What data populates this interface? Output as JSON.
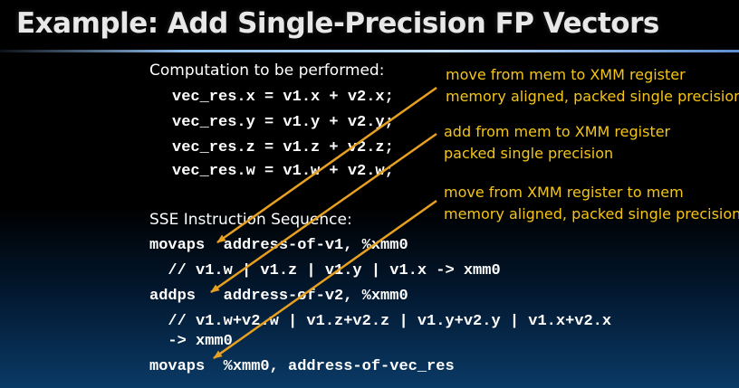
{
  "title": "Example:  Add Single-Precision FP Vectors",
  "computation": {
    "heading": "Computation to be performed:",
    "lines": [
      "vec_res.x = v1.x + v2.x;",
      "vec_res.y = v1.y + v2.y;",
      "vec_res.z = v1.z + v2.z;",
      "vec_res.w = v1.w + v2.w;"
    ]
  },
  "sequence": {
    "heading": "SSE Instruction Sequence:",
    "lines": [
      "movaps  address-of-v1, %xmm0",
      "  // v1.w | v1.z | v1.y | v1.x -> xmm0",
      "addps   address-of-v2, %xmm0",
      "  // v1.w+v2.w | v1.z+v2.z | v1.y+v2.y | v1.x+v2.x",
      "  -> xmm0",
      "movaps  %xmm0, address-of-vec_res"
    ]
  },
  "annotations": [
    {
      "line1": "move from mem to XMM register",
      "line2": "memory aligned, packed single precision"
    },
    {
      "line1": "add from mem to XMM register",
      "line2": "packed single precision"
    },
    {
      "line1": "move from XMM register to mem",
      "line2": "memory aligned, packed single precision"
    }
  ],
  "colors": {
    "annotation": "#f5c518",
    "arrow": "#e8a020",
    "text": "#ffffff"
  }
}
